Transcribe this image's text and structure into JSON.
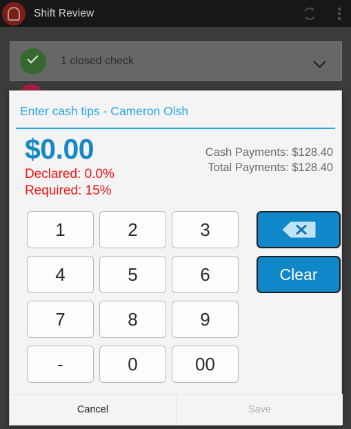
{
  "action_bar": {
    "app_title": "Shift Review",
    "logo_icon": "bread-logo-icon",
    "sync_icon": "refresh-sync-icon",
    "overflow_icon": "overflow-menu-icon",
    "background_color": "#171717",
    "logo_color": "#7b2019"
  },
  "closed_check": {
    "label": "1 closed check",
    "status_icon": "check-circle-icon",
    "status_color": "#36692f",
    "expand_icon": "chevron-down-icon"
  },
  "dialog": {
    "title": "Enter cash tips - Cameron Olsh",
    "title_color": "#2aa6e0",
    "accent_color": "#2aa6e0",
    "amount": "$0.00",
    "amount_color": "#1787c8",
    "declared": "Declared: 0.0%",
    "required": "Required: 15%",
    "warning_color": "#f70f0f",
    "cash_payments": "Cash Payments: $128.40",
    "total_payments": "Total Payments: $128.40",
    "keys": [
      {
        "label": "1",
        "row": 0,
        "col": 0
      },
      {
        "label": "2",
        "row": 0,
        "col": 1
      },
      {
        "label": "3",
        "row": 0,
        "col": 2
      },
      {
        "label": "4",
        "row": 1,
        "col": 0
      },
      {
        "label": "5",
        "row": 1,
        "col": 1
      },
      {
        "label": "6",
        "row": 1,
        "col": 2
      },
      {
        "label": "7",
        "row": 2,
        "col": 0
      },
      {
        "label": "8",
        "row": 2,
        "col": 1
      },
      {
        "label": "9",
        "row": 2,
        "col": 2
      },
      {
        "label": "-",
        "row": 3,
        "col": 0
      },
      {
        "label": "0",
        "row": 3,
        "col": 1
      },
      {
        "label": "00",
        "row": 3,
        "col": 2
      }
    ],
    "backspace_icon": "backspace-delete-icon",
    "clear_label": "Clear",
    "action_button_color": "#0f87c8",
    "cancel_label": "Cancel",
    "save_label": "Save",
    "save_enabled": false
  }
}
